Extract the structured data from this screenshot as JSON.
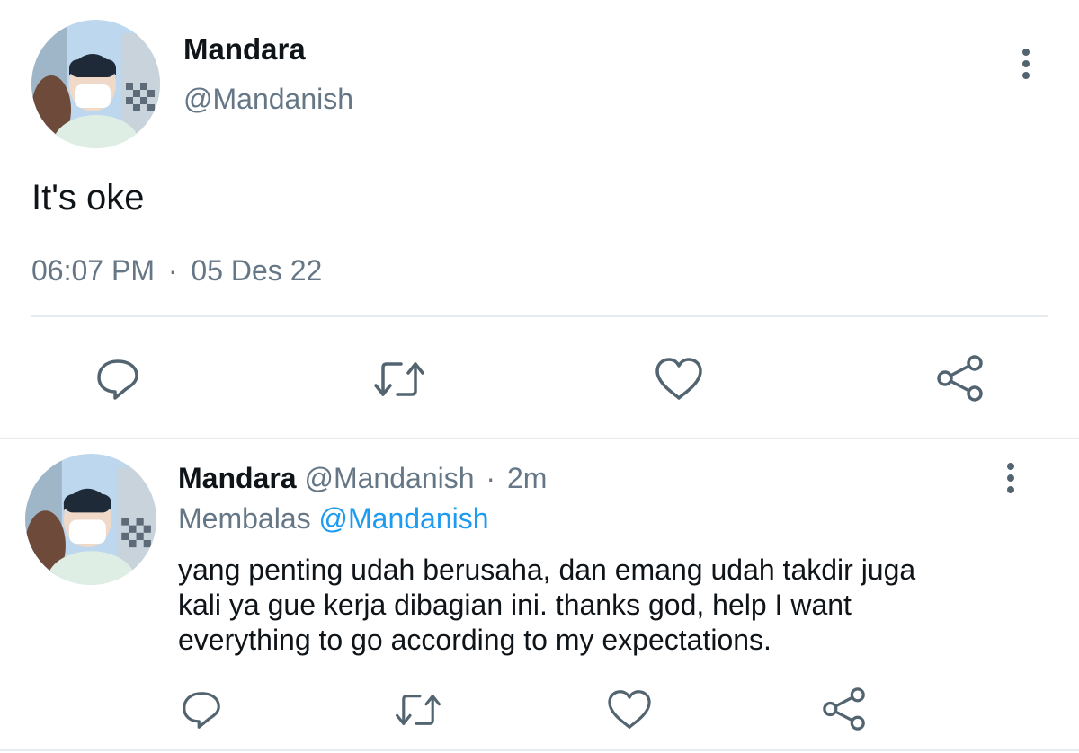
{
  "main_tweet": {
    "display_name": "Mandara",
    "handle": "@Mandanish",
    "text": "It's oke",
    "time": "06:07 PM",
    "separator": "·",
    "date": "05 Des 22",
    "avatar_icon": "profile-photo-avatar",
    "actions": [
      "reply-icon",
      "retweet-icon",
      "like-icon",
      "share-icon"
    ]
  },
  "reply_tweet": {
    "display_name": "Mandara",
    "handle": "@Mandanish",
    "separator": "·",
    "age": "2m",
    "replying_label": "Membalas",
    "replying_to": "@Mandanish",
    "text_lines": [
      "yang penting udah berusaha, dan emang udah takdir juga",
      "kali ya gue kerja dibagian ini. thanks god, help I want",
      "everything to go according to my expectations."
    ],
    "avatar_icon": "profile-photo-avatar",
    "actions": [
      "reply-icon",
      "retweet-icon",
      "like-icon",
      "share-icon"
    ]
  },
  "colors": {
    "text": "#0f1419",
    "muted": "#657786",
    "link": "#1d9bf0",
    "divider": "#e6ecf0",
    "icon": "#536471"
  }
}
